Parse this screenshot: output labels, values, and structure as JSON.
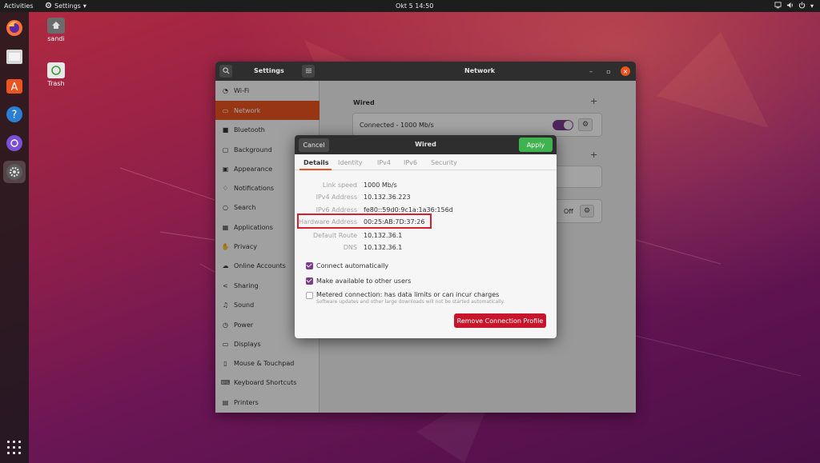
{
  "topbar": {
    "activities": "Activities",
    "app_menu": "Settings",
    "clock": "Okt 5  14:50"
  },
  "desktop": {
    "icons": [
      {
        "label": "sandi",
        "icon": "home-folder-icon"
      },
      {
        "label": "Trash",
        "icon": "trash-icon"
      }
    ]
  },
  "dock": {
    "items": [
      "firefox-icon",
      "files-icon",
      "software-icon",
      "help-icon",
      "screenshot-icon",
      "settings-icon"
    ],
    "active": "settings-icon"
  },
  "settings": {
    "sidebar_title": "Settings",
    "main_title": "Network",
    "sidebar": {
      "items": [
        {
          "label": "Wi-Fi",
          "icon": "wifi-icon"
        },
        {
          "label": "Network",
          "icon": "network-icon",
          "selected": true
        },
        {
          "label": "Bluetooth",
          "icon": "bluetooth-icon"
        },
        {
          "label": "Background",
          "icon": "background-icon"
        },
        {
          "label": "Appearance",
          "icon": "appearance-icon"
        },
        {
          "label": "Notifications",
          "icon": "bell-icon"
        },
        {
          "label": "Search",
          "icon": "search-icon"
        },
        {
          "label": "Applications",
          "icon": "applications-icon"
        },
        {
          "label": "Privacy",
          "icon": "hand-icon"
        },
        {
          "label": "Online Accounts",
          "icon": "cloud-icon"
        },
        {
          "label": "Sharing",
          "icon": "share-icon"
        },
        {
          "label": "Sound",
          "icon": "music-note-icon"
        },
        {
          "label": "Power",
          "icon": "power-icon"
        },
        {
          "label": "Displays",
          "icon": "display-icon"
        },
        {
          "label": "Mouse & Touchpad",
          "icon": "mouse-icon"
        },
        {
          "label": "Keyboard Shortcuts",
          "icon": "keyboard-icon"
        },
        {
          "label": "Printers",
          "icon": "printer-icon"
        }
      ]
    },
    "network": {
      "wired_label": "Wired",
      "wired_status": "Connected - 1000 Mb/s",
      "proxy_state": "Off"
    }
  },
  "dialog": {
    "title": "Wired",
    "cancel": "Cancel",
    "apply": "Apply",
    "tabs": [
      "Details",
      "Identity",
      "IPv4",
      "IPv6",
      "Security"
    ],
    "active_tab": "Details",
    "details": [
      {
        "label": "Link speed",
        "value": "1000 Mb/s"
      },
      {
        "label": "IPv4 Address",
        "value": "10.132.36.223"
      },
      {
        "label": "IPv6 Address",
        "value": "fe80::59d0:9c1a:1a36:156d"
      },
      {
        "label": "Hardware Address",
        "value": "00:25:AB:7D:37:26"
      },
      {
        "label": "Default Route",
        "value": "10.132.36.1"
      },
      {
        "label": "DNS",
        "value": "10.132.36.1"
      }
    ],
    "checks": [
      {
        "label": "Connect automatically",
        "checked": true
      },
      {
        "label": "Make available to other users",
        "checked": true
      },
      {
        "label": "Metered connection: has data limits or can incur charges",
        "checked": false,
        "sub": "Software updates and other large downloads will not be started automatically."
      }
    ],
    "remove": "Remove Connection Profile"
  },
  "colors": {
    "accent": "#e95420",
    "apply_green": "#3eb34f",
    "remove_red": "#c7162b",
    "check_purple": "#7a3b8a",
    "highlight": "#d4202a"
  }
}
